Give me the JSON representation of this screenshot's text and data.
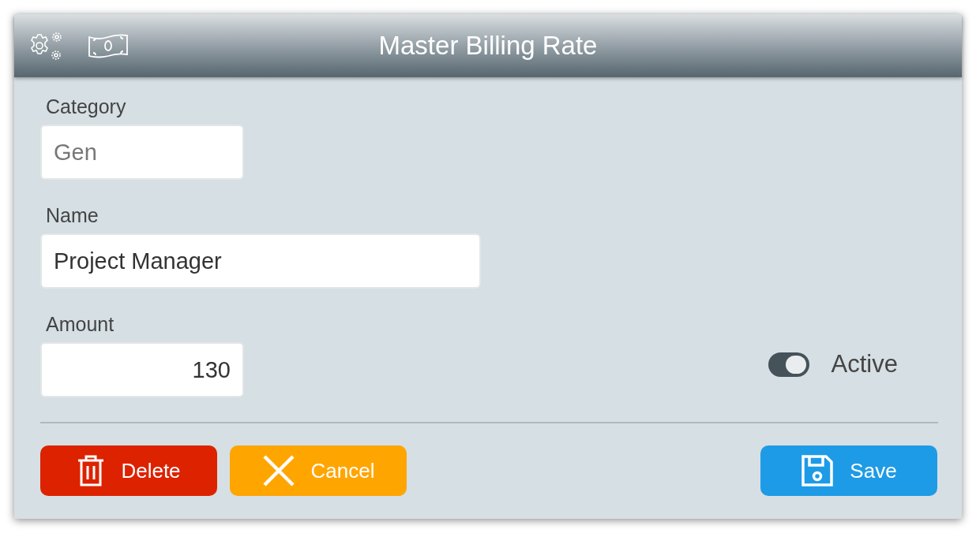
{
  "window": {
    "title": "Master Billing Rate"
  },
  "fields": [
    {
      "kind": "code",
      "label": "Category",
      "placeholder": "Gen"
    },
    {
      "kind": "text",
      "label": "Name",
      "value": "Project Manager"
    },
    {
      "kind": "number",
      "label": "Amount",
      "value": "130"
    }
  ],
  "active": {
    "label": "Active",
    "on": true
  },
  "buttons": [
    {
      "kind": "delete",
      "label": "Delete"
    },
    {
      "kind": "cancel",
      "label": "Cancel"
    },
    {
      "kind": "save",
      "label": "Save"
    }
  ]
}
